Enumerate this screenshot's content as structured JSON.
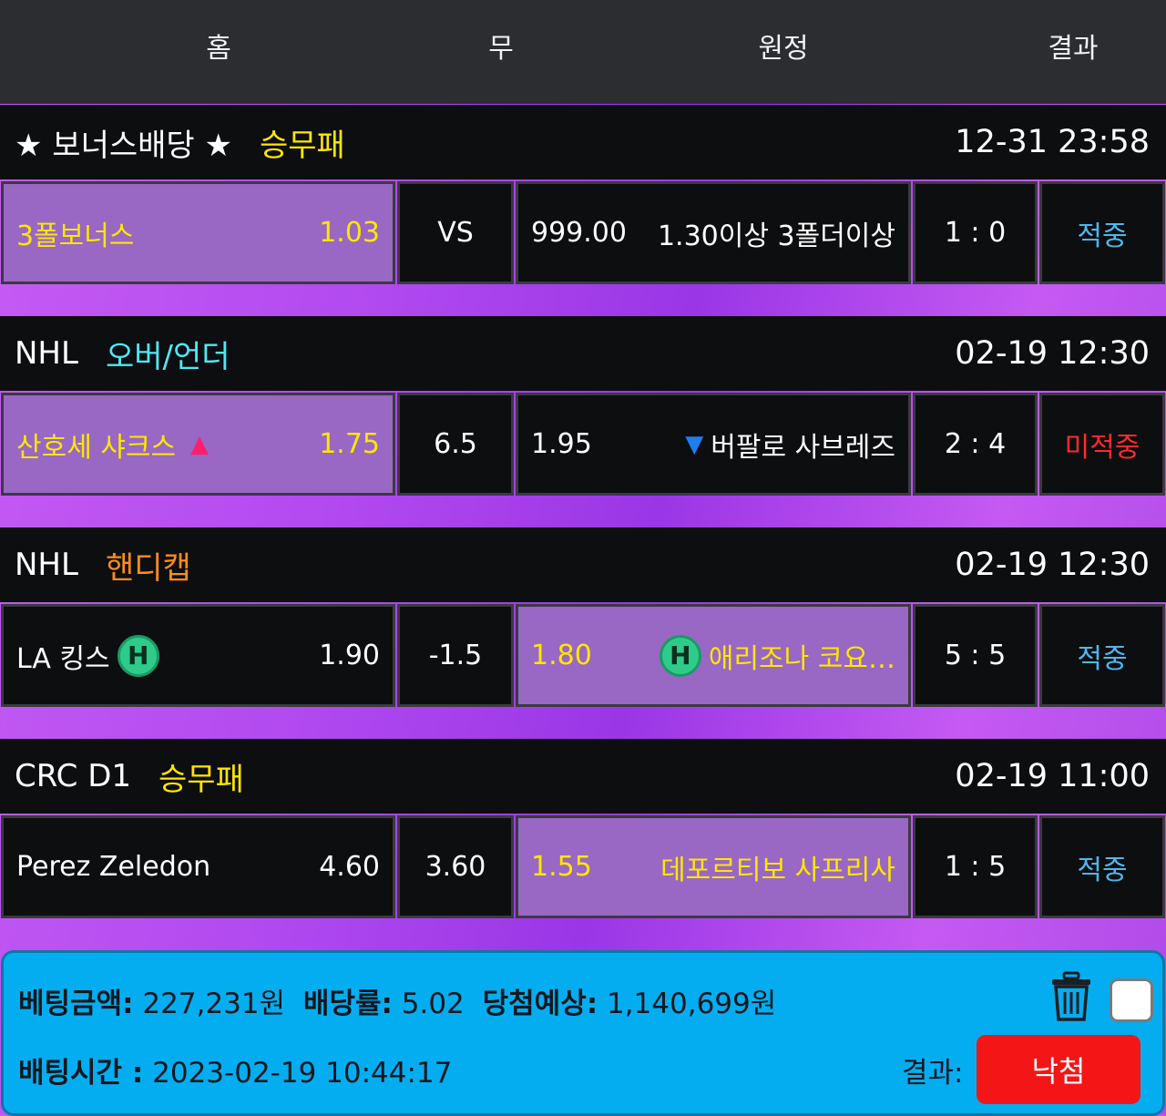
{
  "header": {
    "home": "홈",
    "draw": "무",
    "away": "원정",
    "result": "결과"
  },
  "matches": [
    {
      "league": "★ 보너스배당 ★",
      "bet_type": "승무패",
      "datetime": "12-31 23:58",
      "home_team": "3폴보너스",
      "home_odds": "1.03",
      "draw": "VS",
      "away_odds": "999.00",
      "away_team": "1.30이상 3폴더이상",
      "score": "1 : 0",
      "result": "적중",
      "selected": "home"
    },
    {
      "league": "NHL",
      "bet_type": "오버/언더",
      "datetime": "02-19 12:30",
      "home_team": "산호세 샤크스",
      "home_indicator": "▲",
      "home_odds": "1.75",
      "draw": "6.5",
      "away_odds": "1.95",
      "away_indicator": "▼",
      "away_team": "버팔로 사브레즈",
      "score": "2 : 4",
      "result": "미적중",
      "selected": "home"
    },
    {
      "league": "NHL",
      "bet_type": "핸디캡",
      "datetime": "02-19 12:30",
      "home_team": "LA 킹스",
      "home_badge": "H",
      "home_odds": "1.90",
      "draw": "-1.5",
      "away_odds": "1.80",
      "away_badge": "H",
      "away_team": "애리조나 코요…",
      "score": "5 : 5",
      "result": "적중",
      "selected": "away"
    },
    {
      "league": "CRC D1",
      "bet_type": "승무패",
      "datetime": "02-19 11:00",
      "home_team": "Perez Zeledon",
      "home_odds": "4.60",
      "draw": "3.60",
      "away_odds": "1.55",
      "away_team": "데포르티보 사프리사",
      "score": "1 : 5",
      "result": "적중",
      "selected": "away"
    }
  ],
  "footer": {
    "bet_amount_label": "베팅금액:",
    "bet_amount": "227,231원",
    "odds_label": "배당률:",
    "odds": "5.02",
    "expected_label": "당첨예상:",
    "expected": "1,140,699원",
    "bet_time_label": "배팅시간 :",
    "bet_time": "2023-02-19 10:44:17",
    "result_label": "결과:",
    "result_button": "낙첨"
  },
  "colors": {
    "accent_purple": "#b24bf0",
    "selected_cell": "#9868c4",
    "hit": "#4fb7ee",
    "miss": "#ff2a2a",
    "footer_bg": "#04adef",
    "result_button": "#f41616"
  }
}
